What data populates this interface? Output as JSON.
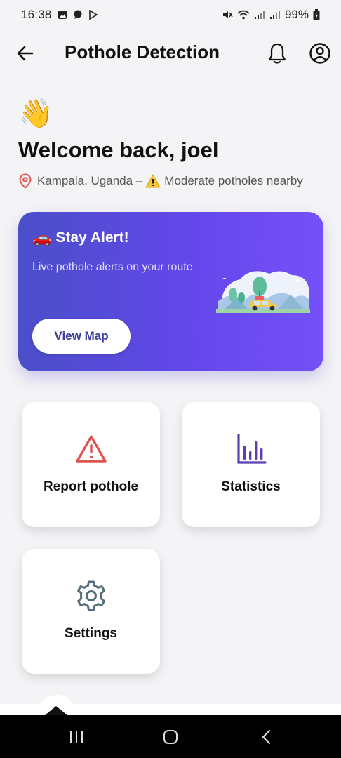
{
  "status_bar": {
    "time": "16:38",
    "battery": "99%"
  },
  "app_bar": {
    "title": "Pothole Detection"
  },
  "greeting": {
    "emoji": "👋",
    "welcome": "Welcome back, joel",
    "location": "Kampala, Uganda –",
    "alert_text": "Moderate potholes nearby"
  },
  "banner": {
    "emoji": "🚗",
    "title": "Stay Alert!",
    "subtitle": "Live pothole alerts on your route",
    "button_label": "View Map"
  },
  "cards": [
    {
      "label": "Report pothole",
      "icon": "warning-icon",
      "color": "#e0524f"
    },
    {
      "label": "Statistics",
      "icon": "bar-chart-icon",
      "color": "#5b3fb0"
    },
    {
      "label": "Settings",
      "icon": "gear-icon",
      "color": "#546e7a"
    }
  ],
  "colors": {
    "banner_start": "#4a4fc9",
    "banner_end": "#7550f8",
    "background": "#f4f4f6"
  }
}
